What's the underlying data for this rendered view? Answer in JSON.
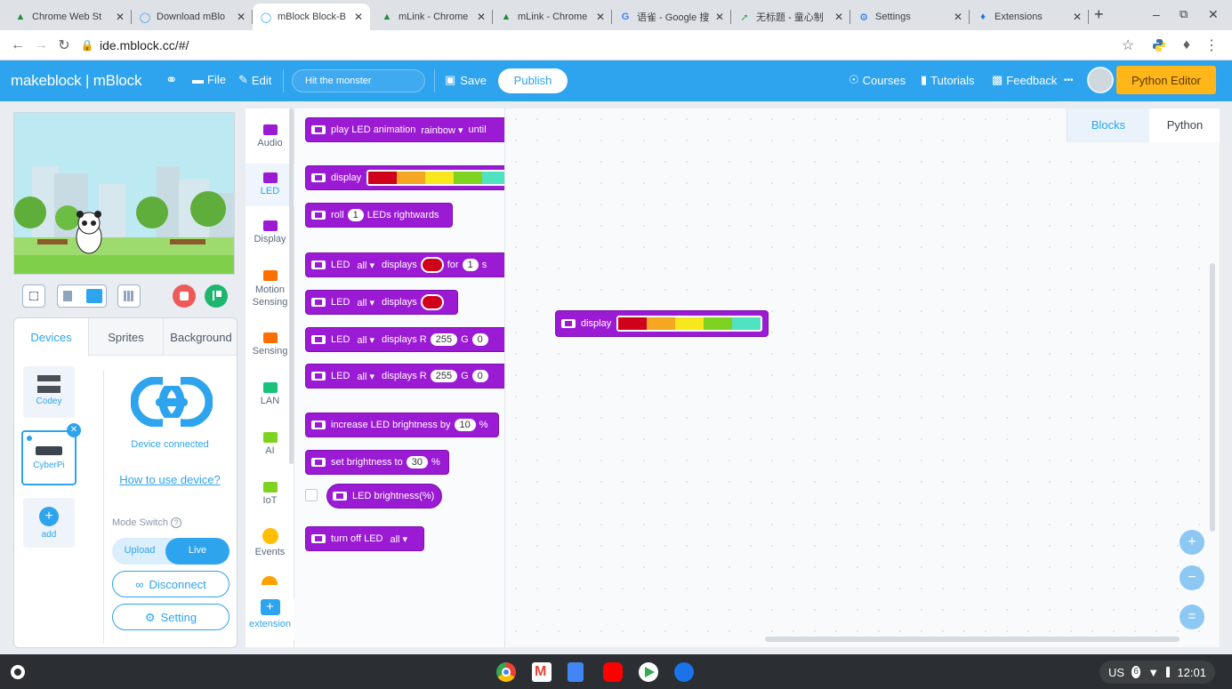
{
  "browser": {
    "tabs": [
      {
        "title": "Chrome Web St",
        "icon": "webstore-icon"
      },
      {
        "title": "Download mBlo",
        "icon": "mblock-icon"
      },
      {
        "title": "mBlock Block-B",
        "icon": "mblock-icon"
      },
      {
        "title": "mLink - Chrome",
        "icon": "webstore-icon"
      },
      {
        "title": "mLink - Chrome",
        "icon": "webstore-icon"
      },
      {
        "title": "语雀 - Google 搜",
        "icon": "google-icon"
      },
      {
        "title": "无标题 - 童心制",
        "icon": "draw-icon"
      },
      {
        "title": "Settings",
        "icon": "settings-icon"
      },
      {
        "title": "Extensions",
        "icon": "extension-icon"
      }
    ],
    "new_tab": "+",
    "url": "ide.mblock.cc/#/"
  },
  "header": {
    "brand": "makeblock | mBlock",
    "file": "File",
    "edit": "Edit",
    "project_name": "Hit the monster",
    "save": "Save",
    "publish": "Publish",
    "courses": "Courses",
    "tutorials": "Tutorials",
    "feedback": "Feedback",
    "more": "•••",
    "python_editor": "Python Editor"
  },
  "panel": {
    "tabs": [
      "Devices",
      "Sprites",
      "Background"
    ],
    "devices": [
      {
        "name": "Codey"
      },
      {
        "name": "CyberPi"
      }
    ],
    "add_label": "add",
    "device_status": "Device connected",
    "how_to": "How to use device?",
    "mode_switch": "Mode Switch",
    "mode_upload": "Upload",
    "mode_live": "Live",
    "disconnect": "Disconnect",
    "setting": "Setting"
  },
  "categories": [
    {
      "label": "Audio",
      "color": "#9b1ad4"
    },
    {
      "label": "LED",
      "color": "#9b1ad4"
    },
    {
      "label": "Display",
      "color": "#9b1ad4"
    },
    {
      "label": "Motion\nSensing",
      "color": "#ff6f00"
    },
    {
      "label": "Sensing",
      "color": "#ff6f00"
    },
    {
      "label": "LAN",
      "color": "#17c37b"
    },
    {
      "label": "AI",
      "color": "#7ed321"
    },
    {
      "label": "IoT",
      "color": "#7ed321"
    },
    {
      "label": "Events",
      "color": "#ffbf00"
    },
    {
      "label": "extension",
      "color": "#2ea3ee"
    }
  ],
  "palette": {
    "b1": {
      "text": "play LED animation",
      "dropdown": "rainbow ▾",
      "tail": "until"
    },
    "b2": {
      "text": "display"
    },
    "b3": {
      "pre": "roll",
      "num": "1",
      "post": "LEDs rightwards"
    },
    "b4": {
      "pre": "LED",
      "dd": "all ▾",
      "mid": "displays",
      "for": "for",
      "num": "1",
      "tail": "s"
    },
    "b5": {
      "pre": "LED",
      "dd": "all ▾",
      "mid": "displays"
    },
    "b6": {
      "pre": "LED",
      "dd": "all ▾",
      "mid": "displays R",
      "r": "255",
      "g": "G",
      "gv": "0"
    },
    "b7": {
      "pre": "LED",
      "dd": "all ▾",
      "mid": "displays R",
      "r": "255",
      "g": "G",
      "gv": "0"
    },
    "b8": {
      "pre": "increase LED brightness by",
      "num": "10",
      "post": "%"
    },
    "b9": {
      "pre": "set brightness to",
      "num": "30",
      "post": "%"
    },
    "b10": {
      "text": "LED brightness(%)"
    },
    "b11": {
      "pre": "turn off LED",
      "dd": "all ▾"
    }
  },
  "led_colors": [
    "#d0021b",
    "#f5a623",
    "#f8e71c",
    "#7ed321",
    "#50e3c2"
  ],
  "workspace": {
    "tab_blocks": "Blocks",
    "tab_python": "Python",
    "block_text": "display",
    "zoom_in": "+",
    "zoom_out": "−",
    "zoom_reset": "="
  },
  "shelf": {
    "locale": "US",
    "notif": "6",
    "time": "12:01"
  }
}
